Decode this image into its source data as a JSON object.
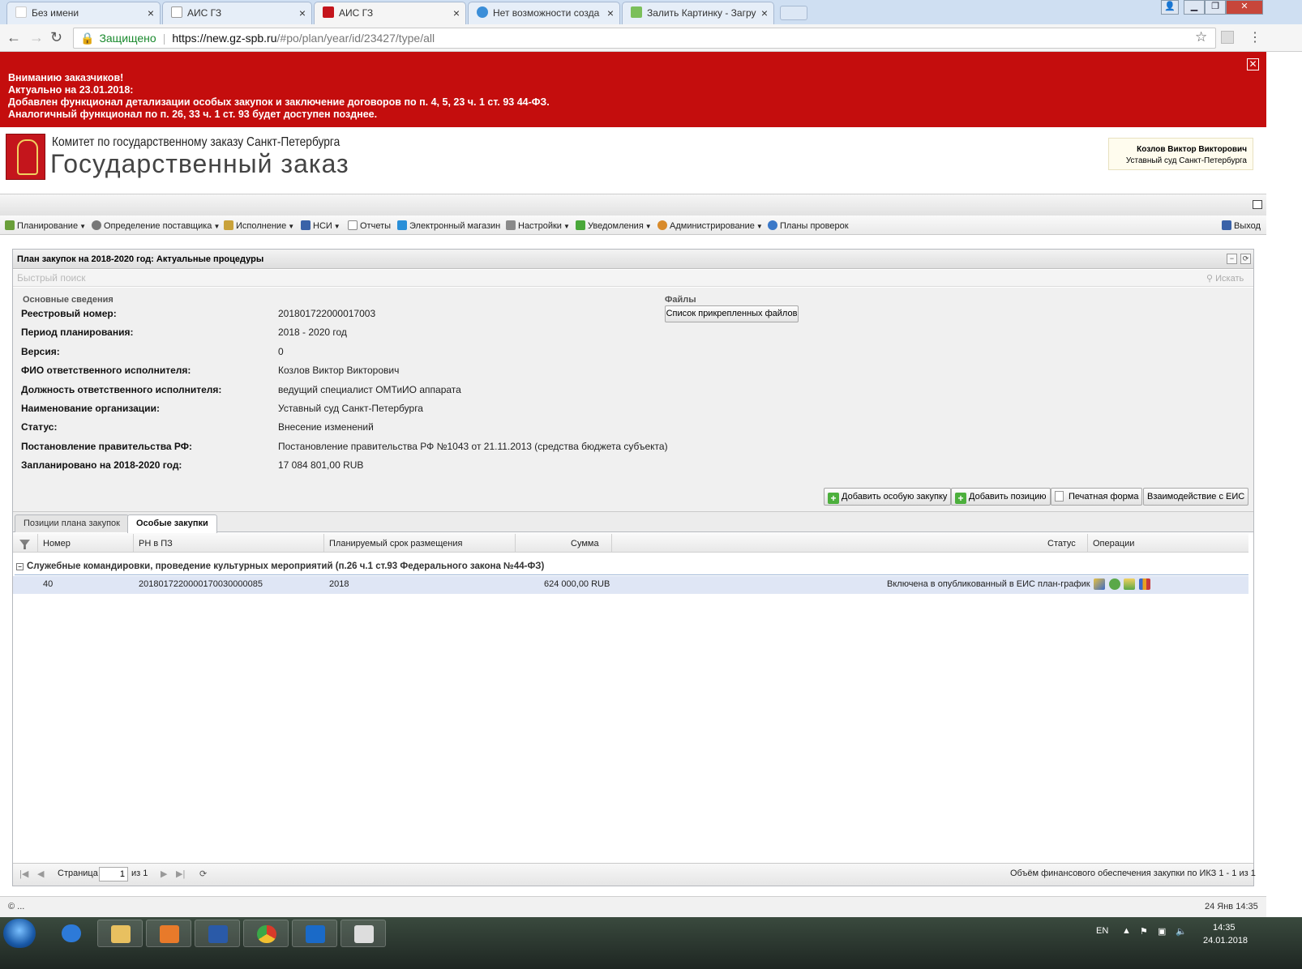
{
  "browser": {
    "tabs": [
      {
        "title": "Без имени",
        "icon_color": "#ffffff"
      },
      {
        "title": "АИС ГЗ",
        "icon_color": "#ffffff"
      },
      {
        "title": "АИС ГЗ",
        "icon_color": "#c4151c"
      },
      {
        "title": "Нет возможности созда",
        "icon_color": "#3b8ed8"
      },
      {
        "title": "Залить Картинку - Загру",
        "icon_color": "#7bbf5a"
      }
    ],
    "close_glyph": "×",
    "secure_label": "Защищено",
    "url_host": "https://new.gz-spb.ru",
    "url_path": "/#po/plan/year/id/23427/type/all"
  },
  "alert": {
    "lines": [
      "Вниманию заказчиков!",
      "Актуально на 23.01.2018:",
      "Добавлен функционал детализации особых закупок и заключение договоров по п. 4, 5, 23 ч. 1 ст. 93 44-ФЗ.",
      "Аналогичный функционал по п. 26, 33 ч. 1 ст. 93 будет доступен позднее."
    ],
    "color": "#c40d0d"
  },
  "header": {
    "org": "Комитет по государственному заказу Санкт-Петербурга",
    "brand": "Государственный заказ",
    "user_name": "Козлов Виктор Викторович",
    "user_org": "Уставный суд Санкт-Петербурга"
  },
  "menu": {
    "items": [
      {
        "label": "Планирование",
        "icon": "planning-icon",
        "dropdown": true
      },
      {
        "label": "Определение поставщика",
        "icon": "gears-icon",
        "dropdown": true
      },
      {
        "label": "Исполнение",
        "icon": "execution-icon",
        "dropdown": true
      },
      {
        "label": "НСИ",
        "icon": "book-icon",
        "dropdown": true
      },
      {
        "label": "Отчеты",
        "icon": "report-icon",
        "dropdown": false
      },
      {
        "label": "Электронный магазин",
        "icon": "cart-icon",
        "dropdown": false
      },
      {
        "label": "Настройки",
        "icon": "wrench-icon",
        "dropdown": true
      },
      {
        "label": "Уведомления",
        "icon": "notification-icon",
        "dropdown": true
      },
      {
        "label": "Администрирование",
        "icon": "user-icon",
        "dropdown": true
      },
      {
        "label": "Планы проверок",
        "icon": "user-icon",
        "dropdown": false
      }
    ],
    "logout": "Выход"
  },
  "panel": {
    "title": "План закупок на 2018-2020 год: Актуальные процедуры",
    "search_placeholder": "Быстрый поиск",
    "search_button": "Искать",
    "basic_title": "Основные сведения",
    "files_title": "Файлы",
    "files_button": "Список прикрепленных файлов",
    "fields": [
      {
        "label": "Реестровый номер:",
        "value": "201801722000017003"
      },
      {
        "label": "Период планирования:",
        "value": "2018 - 2020 год"
      },
      {
        "label": "Версия:",
        "value": "0"
      },
      {
        "label": "ФИО ответственного исполнителя:",
        "value": "Козлов Виктор Викторович"
      },
      {
        "label": "Должность ответственного исполнителя:",
        "value": "ведущий специалист ОМТиИО аппарата"
      },
      {
        "label": "Наименование организации:",
        "value": "Уставный суд Санкт-Петербурга"
      },
      {
        "label": "Статус:",
        "value": "Внесение изменений"
      },
      {
        "label": "Постановление правительства РФ:",
        "value": "Постановление правительства РФ №1043 от 21.11.2013 (средства бюджета субъекта)"
      },
      {
        "label": "Запланировано на 2018-2020 год:",
        "value": "17 084 801,00 RUB"
      }
    ],
    "actions": {
      "add_special": "Добавить особую закупку",
      "add_position": "Добавить позицию",
      "print_form": "Печатная форма",
      "eis": "Взаимодействие с ЕИС"
    }
  },
  "grid": {
    "tabs": [
      "Позиции плана закупок",
      "Особые закупки"
    ],
    "columns": {
      "number": "Номер",
      "rn": "РН в ПЗ",
      "term": "Планируемый срок размещения",
      "sum": "Сумма",
      "status": "Статус",
      "ops": "Операции"
    },
    "group_toggle": "−",
    "group_title": "Служебные командировки, проведение культурных мероприятий (п.26 ч.1 ст.93 Федерального закона №44-ФЗ)",
    "rows": [
      {
        "number": "40",
        "rn": "2018017220000170030000085",
        "term": "2018",
        "sum": "624 000,00 RUB",
        "status": "Включена в опубликованный в ЕИС план-график"
      }
    ]
  },
  "pager": {
    "page_label": "Страница",
    "page_value": "1",
    "of_label": "из 1",
    "summary": "Объём финансового обеспечения закупки по ИКЗ 1 - 1 из 1"
  },
  "footer": {
    "copyright": "© ...",
    "datetime": "24 Янв 14:35"
  },
  "taskbar": {
    "lang": "EN",
    "time": "14:35",
    "date": "24.01.2018"
  }
}
